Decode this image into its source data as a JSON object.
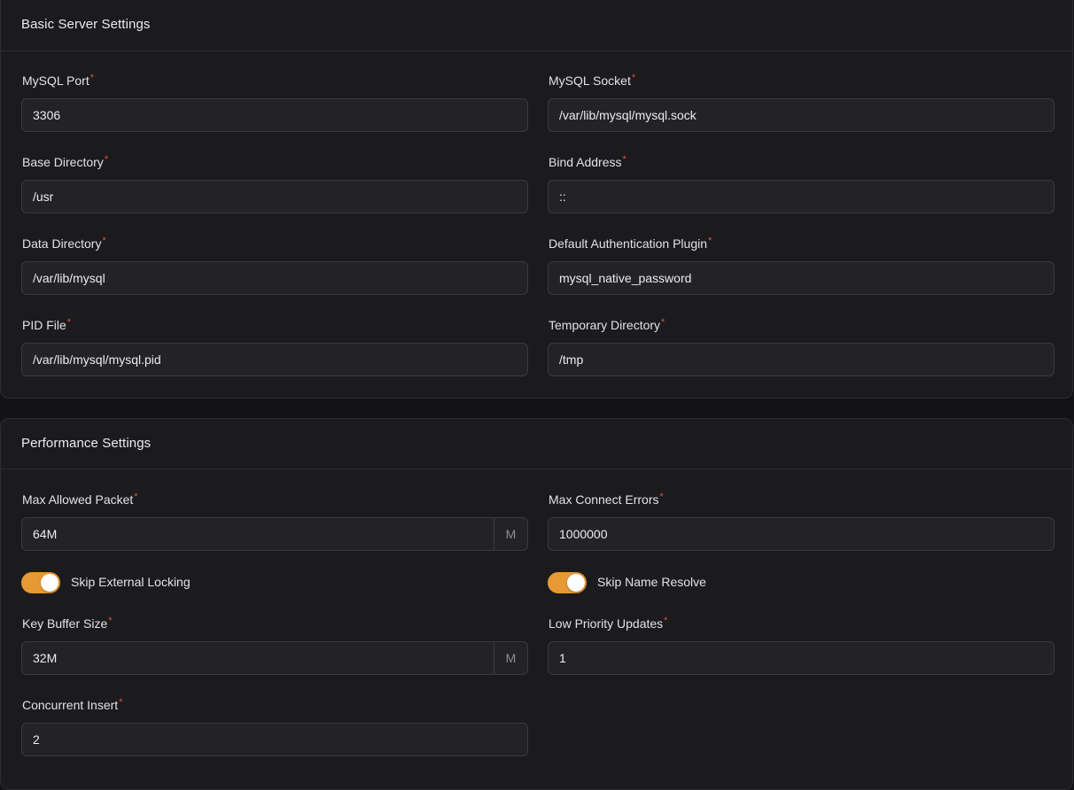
{
  "basic": {
    "title": "Basic Server Settings",
    "required_mark": "*",
    "fields": [
      {
        "label": "MySQL Port",
        "value": "3306"
      },
      {
        "label": "MySQL Socket",
        "value": "/var/lib/mysql/mysql.sock"
      },
      {
        "label": "Base Directory",
        "value": "/usr"
      },
      {
        "label": "Bind Address",
        "value": "::"
      },
      {
        "label": "Data Directory",
        "value": "/var/lib/mysql"
      },
      {
        "label": "Default Authentication Plugin",
        "value": "mysql_native_password"
      },
      {
        "label": "PID File",
        "value": "/var/lib/mysql/mysql.pid"
      },
      {
        "label": "Temporary Directory",
        "value": "/tmp"
      }
    ]
  },
  "performance": {
    "title": "Performance Settings",
    "fields": [
      {
        "label": "Max Allowed Packet",
        "value": "64M",
        "suffix": "M"
      },
      {
        "label": "Max Connect Errors",
        "value": "1000000"
      },
      {
        "label": "Key Buffer Size",
        "value": "32M",
        "suffix": "M"
      },
      {
        "label": "Low Priority Updates",
        "value": "1"
      },
      {
        "label": "Concurrent Insert",
        "value": "2"
      }
    ],
    "toggles": [
      {
        "label": "Skip External Locking",
        "on": true
      },
      {
        "label": "Skip Name Resolve",
        "on": true
      }
    ]
  },
  "colors": {
    "accent": "#e79a33",
    "required": "#e0514a",
    "card_bg": "#1b1b1e",
    "input_bg": "#232327"
  }
}
